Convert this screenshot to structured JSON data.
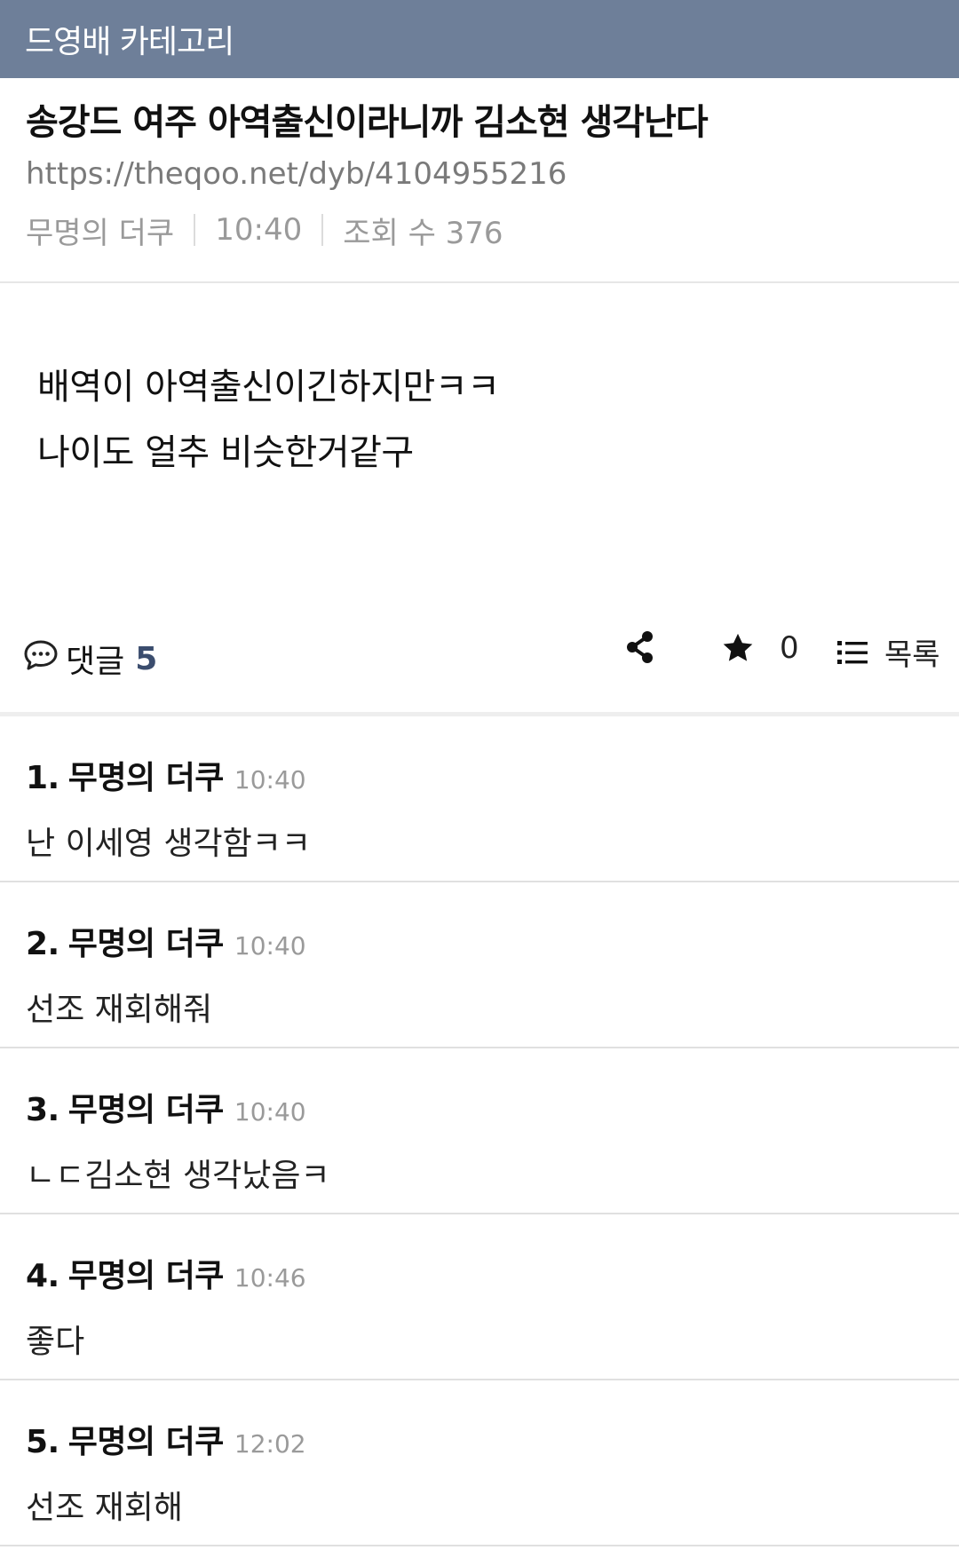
{
  "category": "드영배 카테고리",
  "post": {
    "title": "송강드 여주 아역출신이라니까 김소현 생각난다",
    "url": "https://theqoo.net/dyb/4104955216",
    "author": "무명의 더쿠",
    "time": "10:40",
    "views": "조회 수 376",
    "body_lines": [
      "배역이 아역출신이긴하지만ㅋㅋ",
      "나이도 얼추 비슷한거같구"
    ]
  },
  "actions": {
    "comments_label": "댓글",
    "comments_count": "5",
    "star_count": "0",
    "list_label": "목록",
    "icons": [
      "comment-icon",
      "share-icon",
      "star-icon",
      "list-icon"
    ]
  },
  "comments": [
    {
      "index": "1.",
      "author": "무명의 더쿠",
      "time": "10:40",
      "text": "난 이세영 생각함ㅋㅋ"
    },
    {
      "index": "2.",
      "author": "무명의 더쿠",
      "time": "10:40",
      "text": "선조 재회해줘"
    },
    {
      "index": "3.",
      "author": "무명의 더쿠",
      "time": "10:40",
      "text": "ㄴㄷ김소현 생각났음ㅋ"
    },
    {
      "index": "4.",
      "author": "무명의 더쿠",
      "time": "10:46",
      "text": "좋다"
    },
    {
      "index": "5.",
      "author": "무명의 더쿠",
      "time": "12:02",
      "text": "선조 재회해"
    }
  ],
  "colors": {
    "header_bg": "#6e7f99",
    "comment_count": "#3b4d6e",
    "meta_gray": "#9a9a9a"
  }
}
